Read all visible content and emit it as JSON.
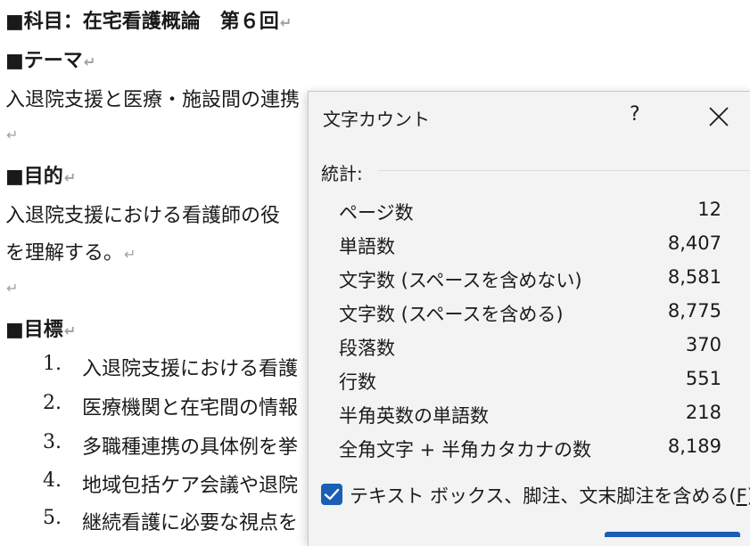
{
  "document": {
    "subject_heading": "■科目：在宅看護概論　第６回",
    "theme_heading": "■テーマ",
    "theme_text": "入退院支援と医療・施設間の連携",
    "purpose_heading": "■目的",
    "purpose_line1": "入退院支援における看護師の役",
    "purpose_line2": "を理解する。",
    "goals_heading": "■目標",
    "goals": [
      {
        "num": "1.",
        "text": "入退院支援における看護"
      },
      {
        "num": "2.",
        "text": "医療機関と在宅間の情報"
      },
      {
        "num": "3.",
        "text": "多職種連携の具体例を挙"
      },
      {
        "num": "4.",
        "text": "地域包括ケア会議や退院"
      },
      {
        "num": "5.",
        "text": "継続看護に必要な視点を"
      }
    ],
    "paragraph_mark": "↵"
  },
  "dialog": {
    "title": "文字カウント",
    "help_label": "?",
    "section_label": "統計:",
    "stats": [
      {
        "label": "ページ数",
        "value": "12"
      },
      {
        "label": "単語数",
        "value": "8,407"
      },
      {
        "label": "文字数 (スペースを含めない)",
        "value": "8,581"
      },
      {
        "label": "文字数 (スペースを含める)",
        "value": "8,775"
      },
      {
        "label": "段落数",
        "value": "370"
      },
      {
        "label": "行数",
        "value": "551"
      },
      {
        "label": "半角英数の単語数",
        "value": "218"
      },
      {
        "label": "全角文字 + 半角カタカナの数",
        "value": "8,189"
      }
    ],
    "checkbox_label": "テキスト ボックス、脚注、文末脚注を含める(",
    "checkbox_accel": "F",
    "checkbox_close": ")",
    "accent_color": "#1a5fb4"
  }
}
